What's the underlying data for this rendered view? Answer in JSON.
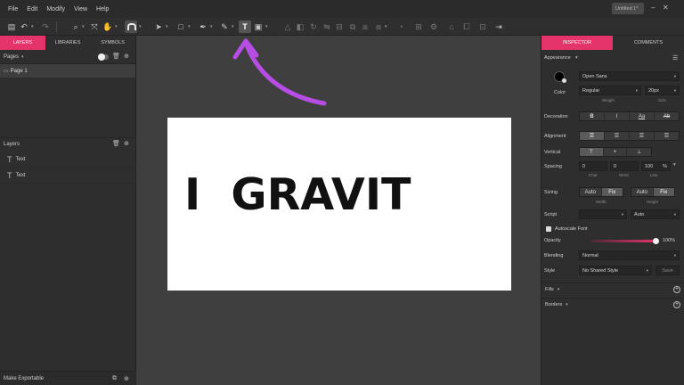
{
  "menubar": {
    "items": [
      "File",
      "Edit",
      "Modify",
      "View",
      "Help"
    ],
    "doc_title": "Untitled 1*",
    "min": "–",
    "close": "✕"
  },
  "left_panel": {
    "tabs": [
      "LAYERS",
      "LIBRARIES",
      "SYMBOLS"
    ],
    "pages_label": "Pages",
    "page_name": "Page 1",
    "layers_label": "Layers",
    "layers": [
      "Text",
      "Text"
    ],
    "footer": "Make Exportable"
  },
  "canvas": {
    "text": "I  GRAVIT"
  },
  "inspector": {
    "tabs": [
      "INSPECTOR",
      "COMMENTS"
    ],
    "appearance": "Appearance",
    "font_family": "Open Sans",
    "color_label": "Color",
    "font_weight": "Regular",
    "weight_label": "Weight",
    "font_size": "20px",
    "size_label": "Size",
    "decoration_label": "Decoration",
    "decoration": [
      "B",
      "I",
      "Aa",
      "Ab"
    ],
    "alignment_label": "Alignment",
    "vertical_label": "Vertical",
    "spacing_label": "Spacing",
    "spacing_values": [
      "0",
      "0",
      "100"
    ],
    "spacing_unit": "%",
    "spacing_sub": [
      "Char",
      "Word",
      "Line"
    ],
    "sizing_label": "Sizing",
    "sizing_width": [
      "Auto",
      "Fix"
    ],
    "sizing_height": [
      "Auto",
      "Fix"
    ],
    "width_label": "Width",
    "height_label": "Height",
    "script_label": "Script",
    "script_value": "Auto",
    "autoscale_label": "Autoscale Font",
    "opacity_label": "Opacity",
    "opacity_value": "100%",
    "opacity": 1.0,
    "blending_label": "Blending",
    "blending_value": "Normal",
    "style_label": "Style",
    "style_value": "No Shared Style",
    "style_button": "Save",
    "fills_label": "Fills",
    "borders_label": "Borders"
  },
  "colors": {
    "accent": "#e5336b",
    "panel": "#2e2e2e",
    "canvas": "#3f3f3f"
  }
}
